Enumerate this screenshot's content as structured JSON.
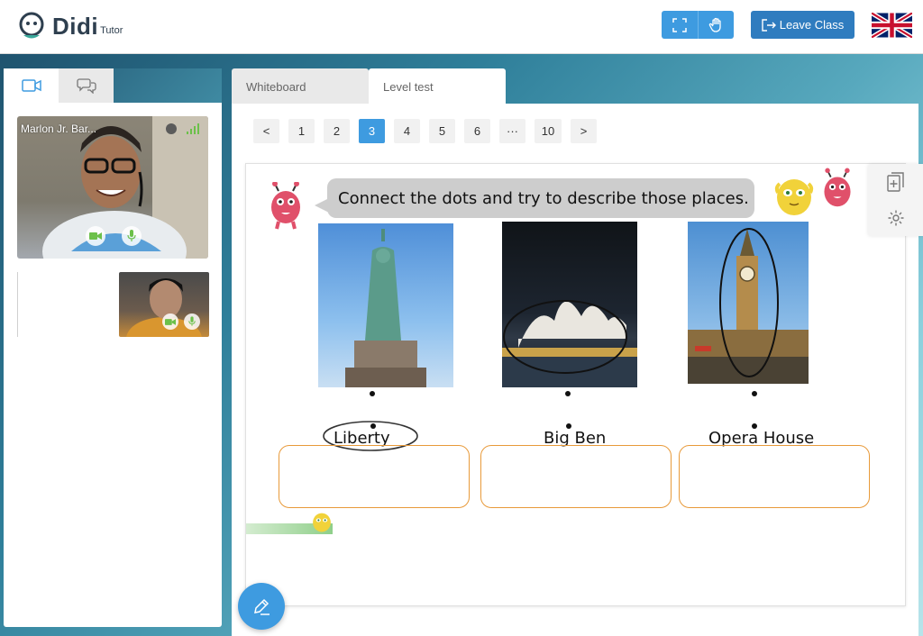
{
  "header": {
    "brand": "Didi",
    "brand_sub": "Tutor",
    "leave_label": "Leave Class",
    "icons": [
      "fullscreen-icon",
      "raise-hand-icon",
      "logout-icon",
      "uk-flag-icon"
    ]
  },
  "sidebar": {
    "tabs": [
      {
        "icon": "video-camera-icon"
      },
      {
        "icon": "chat-icon"
      }
    ],
    "teacher_name": "Marlon Jr. Bar...",
    "icons": [
      "status-dot-icon",
      "signal-icon",
      "camera-icon",
      "mic-icon"
    ]
  },
  "main": {
    "tabs": [
      {
        "label": "Whiteboard"
      },
      {
        "label": "Level test"
      }
    ],
    "pager": {
      "prev": "<",
      "pages": [
        "1",
        "2",
        "3",
        "4",
        "5",
        "6",
        "···",
        "10"
      ],
      "active": "3",
      "next": ">"
    },
    "worksheet": {
      "instruction": "Connect the dots and try to describe those places.",
      "labels": [
        "Liberty",
        "Big Ben",
        "Opera House"
      ]
    },
    "side_tools": [
      "add-page-icon",
      "settings-icon"
    ],
    "fab_icon": "pen-icon"
  },
  "colors": {
    "accent": "#3e9be0",
    "leave_button": "#2f7cbf",
    "answer_border": "#e89a3a"
  }
}
